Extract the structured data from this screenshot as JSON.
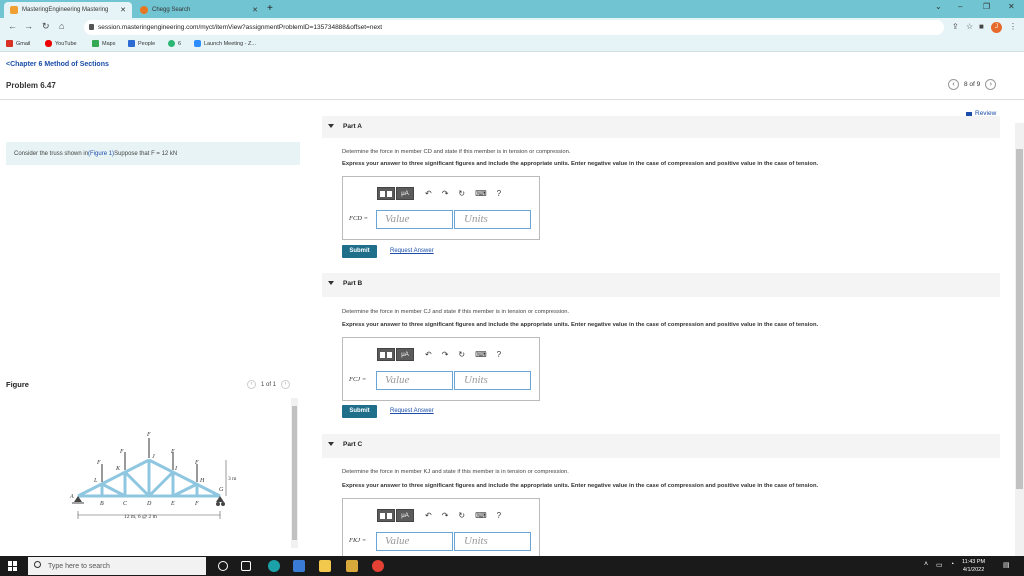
{
  "browser": {
    "tabs": [
      {
        "label": "MasteringEngineering Mastering",
        "active": true
      },
      {
        "label": "Chegg Search",
        "active": false
      }
    ],
    "new_tab": "+",
    "url": "session.masteringengineering.com/myct/itemView?assignmentProblemID=135734888&offset=next",
    "bookmarks": [
      "Gmail",
      "YouTube",
      "Maps",
      "People",
      "6",
      "Launch Meeting - Z..."
    ],
    "profile_initial": "J"
  },
  "header": {
    "chapter_link": "<Chapter 6 Method of Sections",
    "problem_title": "Problem 6.47",
    "pager": "8 of 9",
    "review": "Review"
  },
  "problem": {
    "text_before": "Consider the truss shown in ",
    "figure_link": "(Figure 1)",
    "text_after": " Suppose that F = 12 kN"
  },
  "figure": {
    "label": "Figure",
    "pager": "1 of 1",
    "annotations": {
      "F": "F",
      "joints": [
        "A",
        "B",
        "C",
        "D",
        "E",
        "F",
        "G",
        "H",
        "I",
        "J",
        "K",
        "L"
      ],
      "height": "3 m",
      "span": "12 m, 6 @ 2 m"
    }
  },
  "parts": [
    {
      "label": "Part A",
      "question": "Determine the force in member CD and state if this member is in tension or compression.",
      "instruction": "Express your answer to three significant figures and include the appropriate units. Enter negative value in the case of compression and positive value in the case of tension.",
      "field_label": "FCD =",
      "value_placeholder": "Value",
      "units_placeholder": "Units",
      "submit": "Submit",
      "request": "Request Answer"
    },
    {
      "label": "Part B",
      "question": "Determine the force in member CJ and state if this member is in tension or compression.",
      "instruction": "Express your answer to three significant figures and include the appropriate units. Enter negative value in the case of compression and positive value in the case of tension.",
      "field_label": "FCJ =",
      "value_placeholder": "Value",
      "units_placeholder": "Units",
      "submit": "Submit",
      "request": "Request Answer"
    },
    {
      "label": "Part C",
      "question": "Determine the force in member KJ and state if this member is in tension or compression.",
      "instruction": "Express your answer to three significant figures and include the appropriate units. Enter negative value in the case of compression and positive value in the case of tension.",
      "field_label": "FKJ =",
      "value_placeholder": "Value",
      "units_placeholder": "Units"
    }
  ],
  "toolbar": {
    "mu": "μA",
    "help": "?"
  },
  "taskbar": {
    "search_placeholder": "Type here to search",
    "time": "11:43 PM",
    "date": "4/1/2022"
  },
  "colors": {
    "tab_bar": "#71c4d1",
    "submit": "#1f6f8b",
    "link": "#1a4ea8",
    "truss": "#8fc6e0"
  }
}
